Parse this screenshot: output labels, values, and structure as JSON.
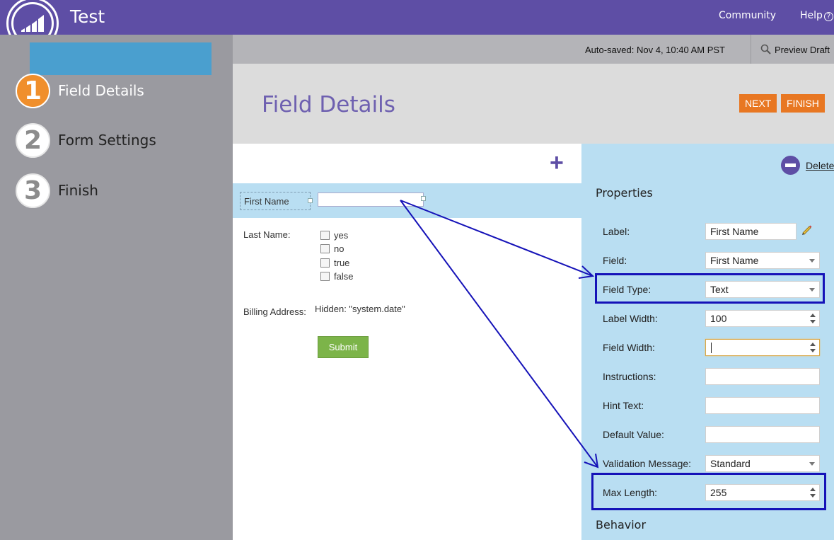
{
  "app": {
    "title": "Test"
  },
  "topnav": {
    "community": "Community",
    "help": "Help",
    "help_icon": "?"
  },
  "steps": [
    {
      "num": "1",
      "label": "Field Details",
      "active": true
    },
    {
      "num": "2",
      "label": "Form Settings",
      "active": false
    },
    {
      "num": "3",
      "label": "Finish",
      "active": false
    }
  ],
  "toolbar": {
    "autosave": "Auto-saved: Nov 4, 10:40 AM PST",
    "preview": "Preview Draft"
  },
  "header": {
    "title": "Field Details",
    "next": "NEXT",
    "finish": "FINISH"
  },
  "canvas": {
    "add_icon": "+",
    "first_name_label": "First Name",
    "last_name_label": "Last Name:",
    "options": [
      "yes",
      "no",
      "true",
      "false"
    ],
    "billing_label": "Billing Address:",
    "hidden_value": "Hidden: \"system.date\"",
    "submit": "Submit"
  },
  "properties": {
    "delete": "Delete",
    "heading": "Properties",
    "behavior": "Behavior",
    "fields": {
      "label": {
        "label": "Label:",
        "value": "First Name"
      },
      "field": {
        "label": "Field:",
        "value": "First Name"
      },
      "field_type": {
        "label": "Field Type:",
        "value": "Text"
      },
      "label_width": {
        "label": "Label Width:",
        "value": "100"
      },
      "field_width": {
        "label": "Field Width:",
        "value": ""
      },
      "instructions": {
        "label": "Instructions:",
        "value": ""
      },
      "hint_text": {
        "label": "Hint Text:",
        "value": ""
      },
      "default_value": {
        "label": "Default Value:",
        "value": ""
      },
      "validation_message": {
        "label": "Validation Message:",
        "value": "Standard"
      },
      "max_length": {
        "label": "Max Length:",
        "value": "255"
      }
    }
  },
  "colors": {
    "brand": "#5e4ea5",
    "accent_orange": "#e87722",
    "panel_blue": "#b9def2",
    "annotation": "#1512b8"
  }
}
